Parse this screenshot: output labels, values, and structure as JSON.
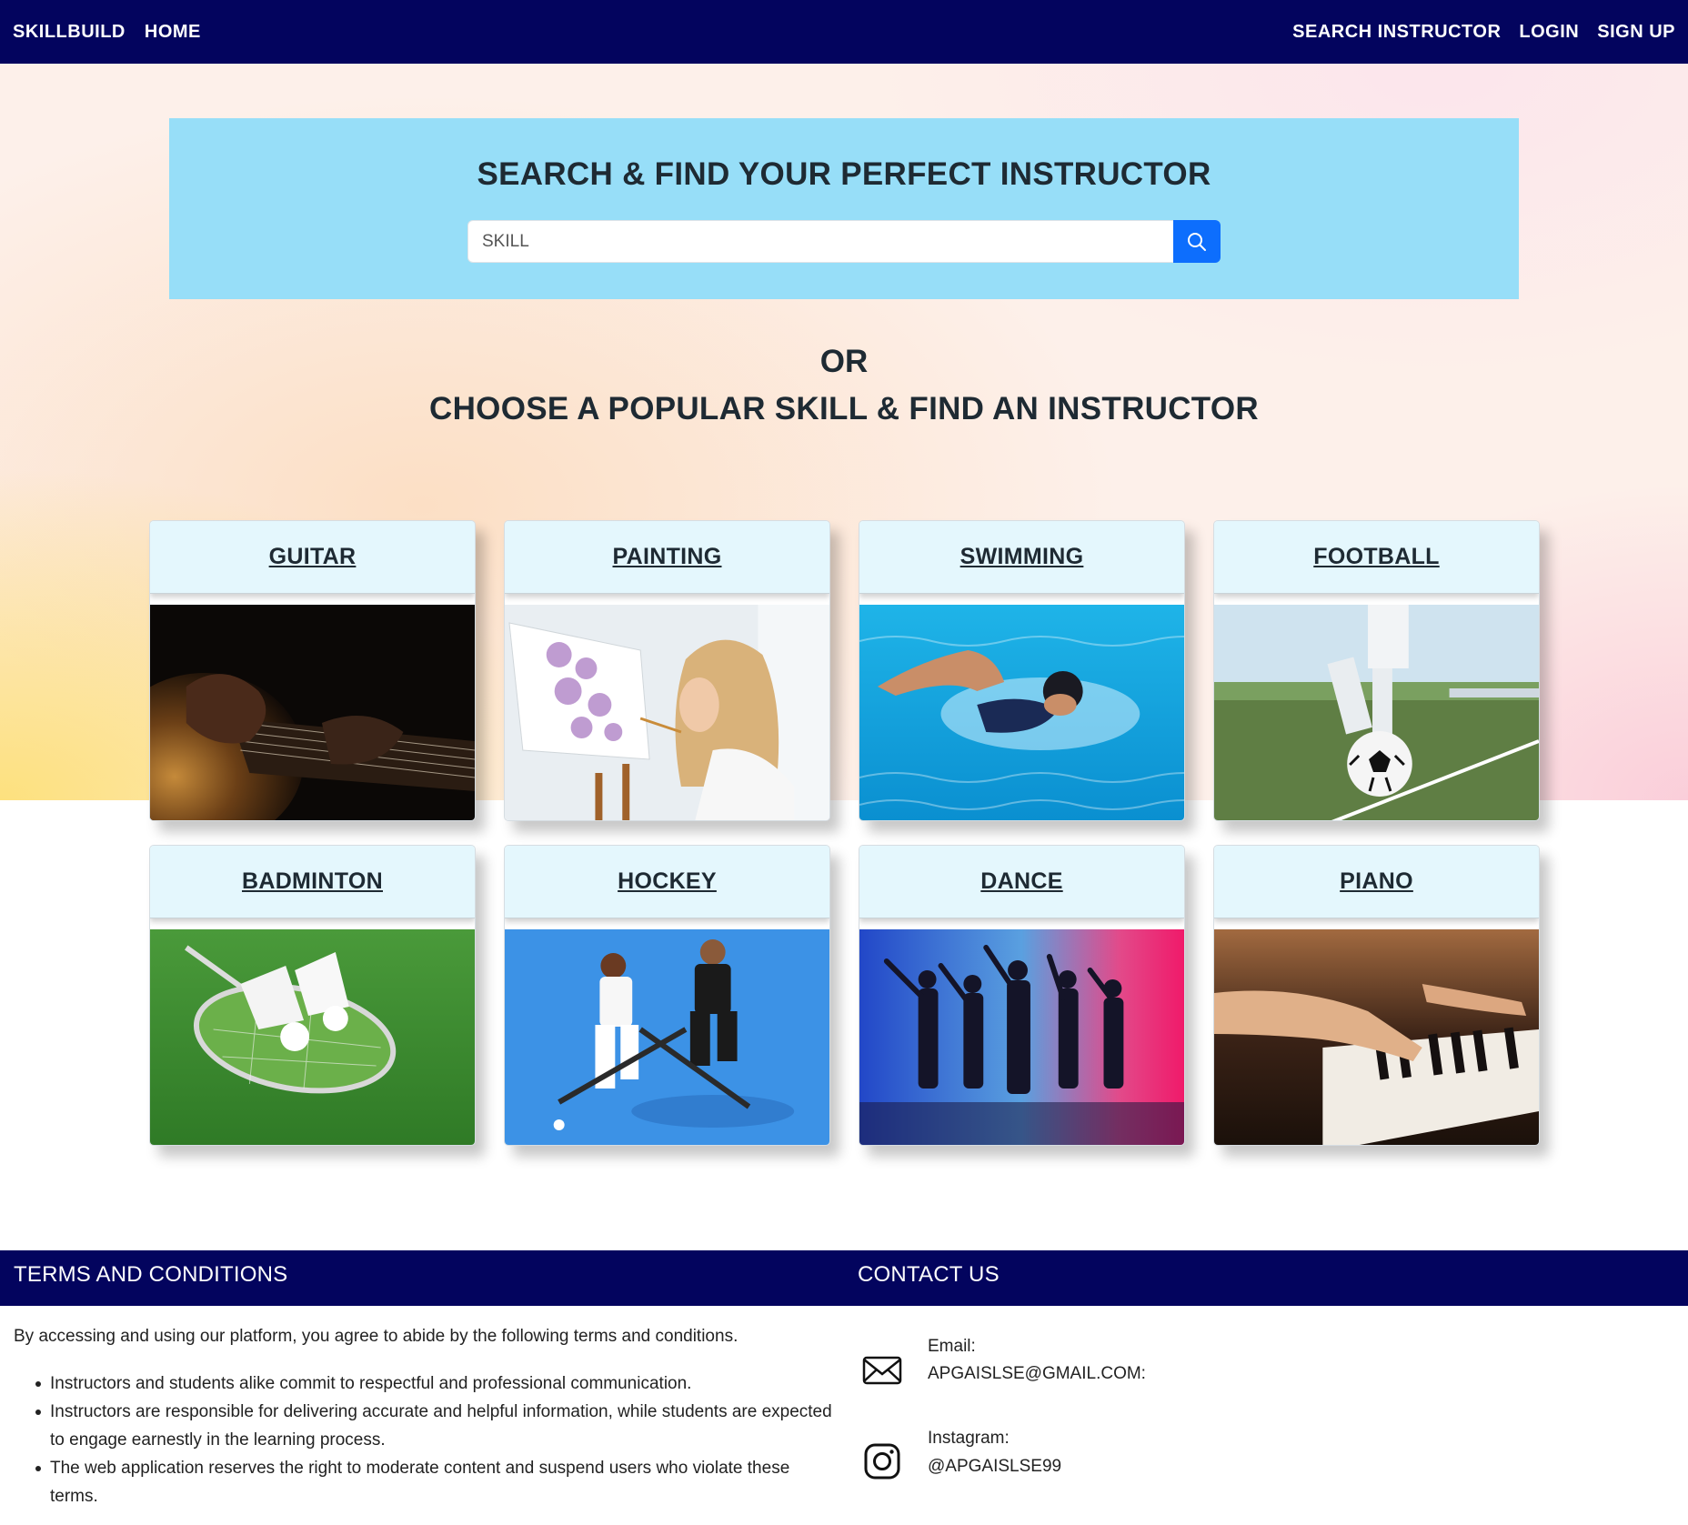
{
  "navbar": {
    "brand": "SKILLBUILD",
    "home": "HOME",
    "search_instructor": "SEARCH INSTRUCTOR",
    "login": "LOGIN",
    "signup": "SIGN UP",
    "bg_color": "#03045e"
  },
  "search": {
    "title": "SEARCH & FIND YOUR PERFECT INSTRUCTOR",
    "placeholder": "SKILL",
    "button_icon": "search-icon",
    "button_color": "#0d6efd"
  },
  "popular": {
    "or_text": "OR",
    "heading": "CHOOSE A POPULAR SKILL & FIND AN INSTRUCTOR",
    "skills": [
      {
        "label": "GUITAR",
        "image": "guitar-photo"
      },
      {
        "label": "PAINTING",
        "image": "painting-photo"
      },
      {
        "label": "SWIMMING",
        "image": "swimming-photo"
      },
      {
        "label": "FOOTBALL",
        "image": "football-photo"
      },
      {
        "label": "BADMINTON",
        "image": "badminton-photo"
      },
      {
        "label": "HOCKEY",
        "image": "hockey-photo"
      },
      {
        "label": "DANCE",
        "image": "dance-photo"
      },
      {
        "label": "PIANO",
        "image": "piano-photo"
      }
    ]
  },
  "footer": {
    "terms_heading": "TERMS AND CONDITIONS",
    "terms_intro": "By accessing and using our platform, you agree to abide by the following terms and conditions.",
    "terms_items": [
      "Instructors and students alike commit to respectful and professional communication.",
      "Instructors are responsible for delivering accurate and helpful information, while students are expected to engage earnestly in the learning process.",
      "The web application reserves the right to moderate content and suspend users who violate these terms."
    ],
    "contact_heading": "CONTACT US",
    "email_label": "Email:",
    "email_value": "APGAISLSE@GMAIL.COM:",
    "email_icon": "envelope-icon",
    "instagram_label": "Instagram:",
    "instagram_value": "@APGAISLSE99",
    "instagram_icon": "instagram-icon"
  }
}
